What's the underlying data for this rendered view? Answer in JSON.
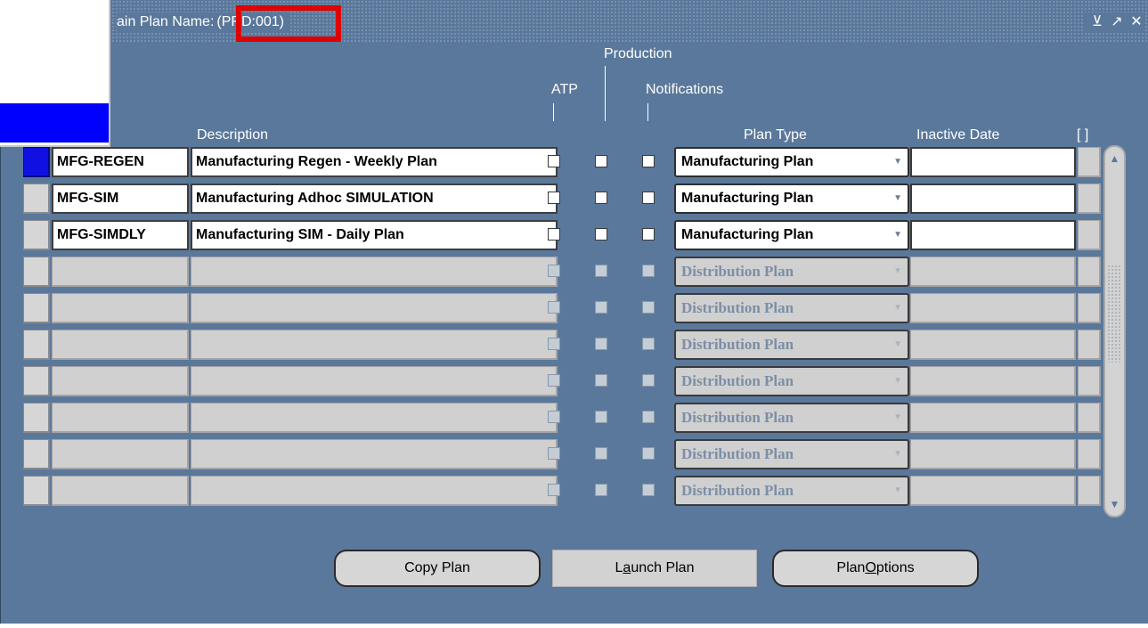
{
  "window": {
    "title_label": "ain Plan Name:",
    "title_code": "(PRD:001)",
    "controls": [
      "⊻",
      "↗",
      "✕"
    ]
  },
  "headers": {
    "production": "Production",
    "atp": "ATP",
    "notifications": "Notifications",
    "description": "Description",
    "plan_type": "Plan Type",
    "inactive_date": "Inactive Date",
    "flex": "[ ]"
  },
  "rows": [
    {
      "name": "MFG-REGEN",
      "description": "Manufacturing Regen - Weekly Plan",
      "plan_type": "Manufacturing Plan",
      "inactive_date": "",
      "active": true,
      "selected": true
    },
    {
      "name": "MFG-SIM",
      "description": "Manufacturing Adhoc SIMULATION",
      "plan_type": "Manufacturing Plan",
      "inactive_date": "",
      "active": true,
      "selected": false
    },
    {
      "name": "MFG-SIMDLY",
      "description": "Manufacturing SIM - Daily Plan",
      "plan_type": "Manufacturing Plan",
      "inactive_date": "",
      "active": true,
      "selected": false
    },
    {
      "name": "",
      "description": "",
      "plan_type": "Distribution Plan",
      "inactive_date": "",
      "active": false,
      "selected": false
    },
    {
      "name": "",
      "description": "",
      "plan_type": "Distribution Plan",
      "inactive_date": "",
      "active": false,
      "selected": false
    },
    {
      "name": "",
      "description": "",
      "plan_type": "Distribution Plan",
      "inactive_date": "",
      "active": false,
      "selected": false
    },
    {
      "name": "",
      "description": "",
      "plan_type": "Distribution Plan",
      "inactive_date": "",
      "active": false,
      "selected": false
    },
    {
      "name": "",
      "description": "",
      "plan_type": "Distribution Plan",
      "inactive_date": "",
      "active": false,
      "selected": false
    },
    {
      "name": "",
      "description": "",
      "plan_type": "Distribution Plan",
      "inactive_date": "",
      "active": false,
      "selected": false
    },
    {
      "name": "",
      "description": "",
      "plan_type": "Distribution Plan",
      "inactive_date": "",
      "active": false,
      "selected": false
    }
  ],
  "buttons": {
    "copy_plan": "Copy Plan",
    "launch_plan_pre": "L",
    "launch_plan_u": "a",
    "launch_plan_post": "unch Plan",
    "plan_options_pre": "Plan ",
    "plan_options_u": "O",
    "plan_options_post": "ptions"
  },
  "scrollbar": {
    "up_icon": "▲",
    "down_icon": "▼"
  }
}
